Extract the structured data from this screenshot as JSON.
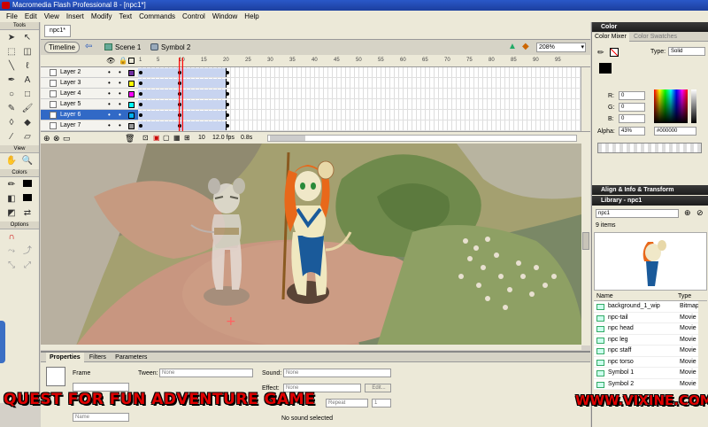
{
  "window": {
    "title": "Macromedia Flash Professional 8 - [npc1*]"
  },
  "menu": [
    "File",
    "Edit",
    "View",
    "Insert",
    "Modify",
    "Text",
    "Commands",
    "Control",
    "Window",
    "Help"
  ],
  "tools": {
    "section_tools": "Tools",
    "section_view": "View",
    "section_colors": "Colors",
    "section_options": "Options"
  },
  "document": {
    "tab": "npc1*",
    "timeline_btn": "Timeline",
    "scene": "Scene 1",
    "symbol": "Symbol 2",
    "zoom": "208%"
  },
  "timeline": {
    "layers": [
      {
        "name": "Layer 2",
        "color": "#7030a0"
      },
      {
        "name": "Layer 3",
        "color": "#ffff00"
      },
      {
        "name": "Layer 4",
        "color": "#ff00ff"
      },
      {
        "name": "Layer 5",
        "color": "#00ffff"
      },
      {
        "name": "Layer 6",
        "color": "#00b0f0"
      },
      {
        "name": "Layer 7",
        "color": "#999999"
      }
    ],
    "ruler": [
      "1",
      "5",
      "10",
      "15",
      "20",
      "25",
      "30",
      "35",
      "40",
      "45",
      "50",
      "55",
      "60",
      "65",
      "70",
      "75",
      "80",
      "85",
      "90",
      "95"
    ],
    "current_frame": "10",
    "fps": "12.0 fps",
    "time": "0.8s"
  },
  "properties": {
    "tabs": [
      "Properties",
      "Filters",
      "Parameters"
    ],
    "frame_label": "Frame",
    "tween_label": "Tween:",
    "tween_value": "None",
    "sound_label": "Sound:",
    "sound_value": "None",
    "effect_label": "Effect:",
    "effect_value": "None",
    "edit_btn": "Edit...",
    "repeat_value": "Repeat",
    "repeat_count": "1",
    "name_placeholder": "Name",
    "no_sound": "No sound selected"
  },
  "color_panel": {
    "title": "Color",
    "tab_mixer": "Color Mixer",
    "tab_swatches": "Color Swatches",
    "type_label": "Type:",
    "type_value": "Solid",
    "r_label": "R:",
    "r_value": "0",
    "g_label": "G:",
    "g_value": "0",
    "b_label": "B:",
    "b_value": "0",
    "alpha_label": "Alpha:",
    "alpha_value": "43%",
    "hex_value": "#000000"
  },
  "align_panel": {
    "title": "Align & Info & Transform"
  },
  "library": {
    "title": "Library - npc1",
    "dropdown": "npc1",
    "count": "9 items",
    "col_name": "Name",
    "col_type": "Type",
    "items": [
      {
        "name": "background_1_wip",
        "type": "Bitmap"
      },
      {
        "name": "npc-tail",
        "type": "Movie"
      },
      {
        "name": "npc head",
        "type": "Movie"
      },
      {
        "name": "npc leg",
        "type": "Movie"
      },
      {
        "name": "npc staff",
        "type": "Movie"
      },
      {
        "name": "npc torso",
        "type": "Movie"
      },
      {
        "name": "Symbol 1",
        "type": "Movie"
      },
      {
        "name": "Symbol 2",
        "type": "Movie"
      }
    ]
  },
  "overlay": {
    "left": "QUEST FOR FUN ADVENTURE GAME",
    "right": "WWW.VIXINE.COM"
  }
}
